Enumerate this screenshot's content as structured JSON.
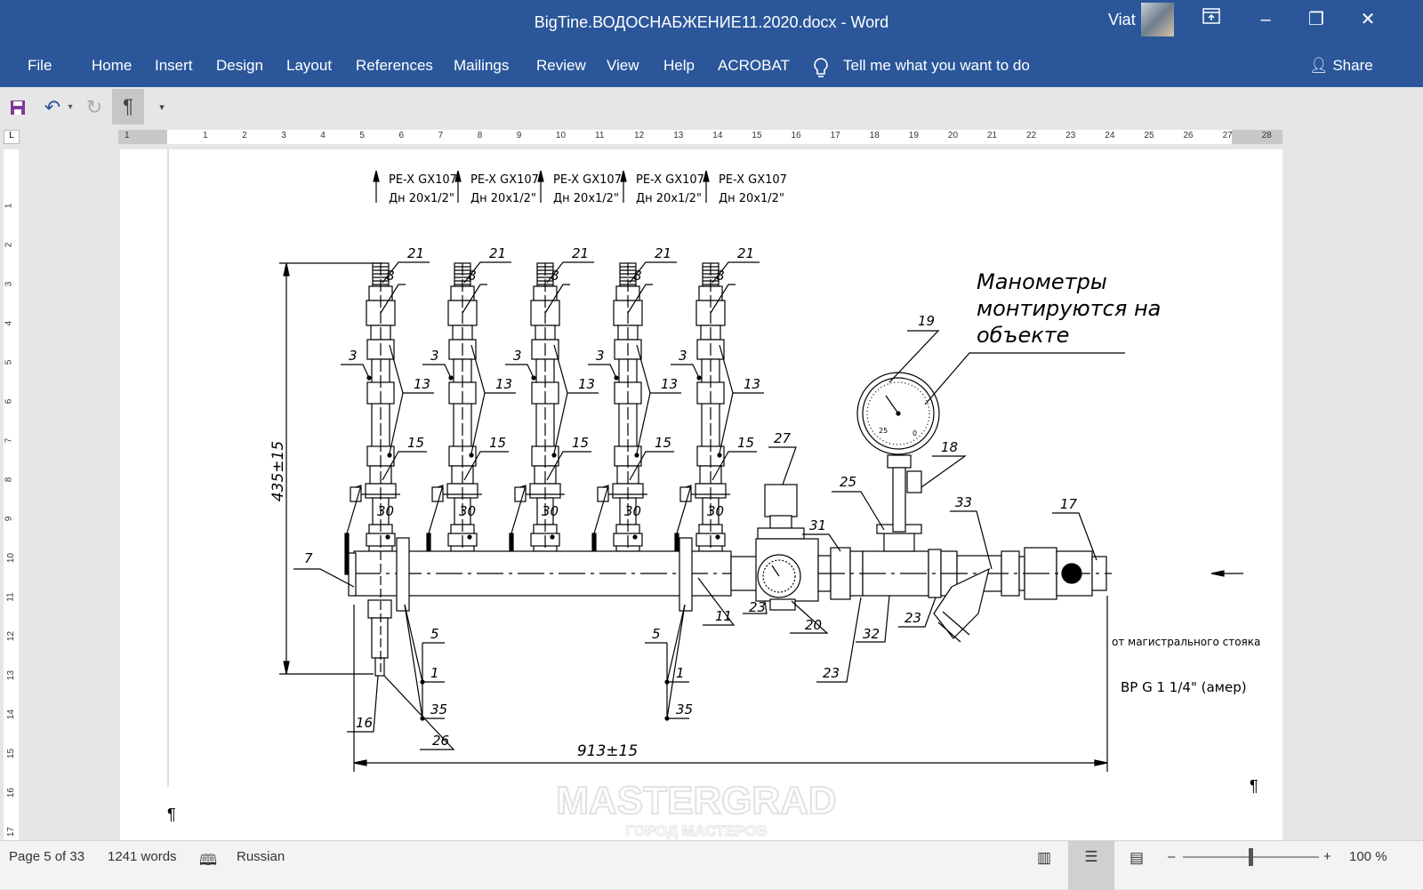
{
  "window": {
    "title": "BigTine.ВОДОСНАБЖЕНИЕ11.2020.docx  -  Word",
    "user": "Viat F",
    "ribbon_display_icon": "ribbon-display-icon",
    "minimize": "–",
    "restore": "❐",
    "close": "✕"
  },
  "ribbon": {
    "tabs": [
      "File",
      "Home",
      "Insert",
      "Design",
      "Layout",
      "References",
      "Mailings",
      "Review",
      "View",
      "Help",
      "ACROBAT"
    ],
    "tell_me": "Tell me what you want to do",
    "share": "Share"
  },
  "qat": {
    "save": "save-icon",
    "undo": "undo-icon",
    "redo": "redo-icon",
    "pilcrow": "¶",
    "customize": "▾"
  },
  "ruler": {
    "ticks": [
      "1",
      "1",
      "2",
      "3",
      "4",
      "5",
      "6",
      "7",
      "8",
      "9",
      "10",
      "11",
      "12",
      "13",
      "14",
      "15",
      "16",
      "17",
      "18",
      "19",
      "20",
      "21",
      "22",
      "23",
      "24",
      "25",
      "26",
      "27",
      "28"
    ]
  },
  "document": {
    "pipe_labels": [
      {
        "line1": "PE-X GX107",
        "line2": "Дн 20x1/2\""
      },
      {
        "line1": "PE-X GX107",
        "line2": "Дн 20x1/2\""
      },
      {
        "line1": "PE-X GX107",
        "line2": "Дн 20x1/2\""
      },
      {
        "line1": "PE-X GX107",
        "line2": "Дн 20x1/2\""
      },
      {
        "line1": "PE-X GX107",
        "line2": "Дн 20x1/2\""
      }
    ],
    "riser_callouts": [
      "21",
      "8",
      "3",
      "13",
      "15",
      "30"
    ],
    "callouts": [
      "7",
      "16",
      "26",
      "5",
      "1",
      "35",
      "5",
      "1",
      "35",
      "11",
      "23",
      "20",
      "23",
      "32",
      "23",
      "27",
      "31",
      "25",
      "19",
      "18",
      "33",
      "17"
    ],
    "note": [
      "Манометры",
      "монтируются на",
      "объекте"
    ],
    "height_dim": "435±15",
    "width_dim": "913±15",
    "source_label": "от магистрального стояка",
    "thread_label": "ВР G 1 1/4\" (амер)",
    "gauge_marks": [
      "25",
      "0"
    ],
    "pilcrow": "¶",
    "watermark": {
      "main": "MASTERGRAD",
      "sub": "ГОРОД МАСТЕРОВ"
    }
  },
  "status": {
    "page": "Page 5 of 33",
    "words": "1241 words",
    "language": "Russian",
    "zoom": "100 %",
    "zoom_level_percent": 100
  }
}
